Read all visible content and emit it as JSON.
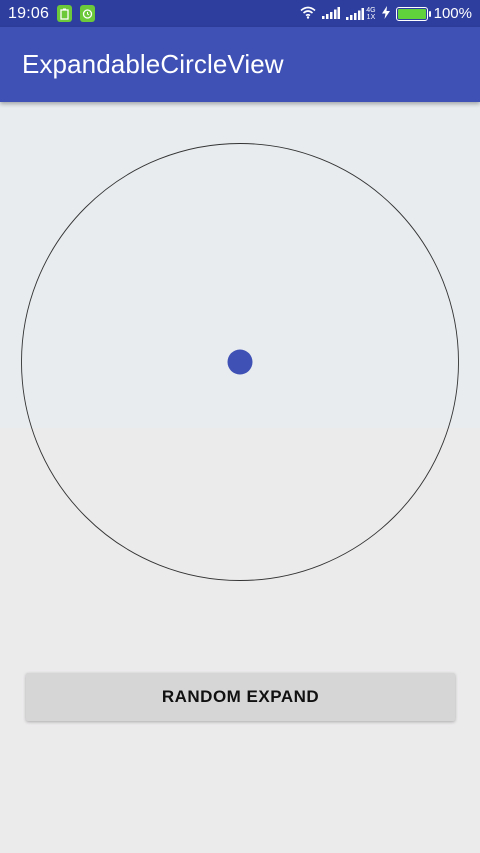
{
  "status_bar": {
    "time": "19:06",
    "network_top": "4G",
    "network_bottom": "1X",
    "battery_percent": "100%",
    "battery_level": 1.0,
    "icons": [
      "battery-notification-icon",
      "alarm-notification-icon",
      "wifi-icon",
      "signal-icon",
      "signal-4g-icon",
      "charging-icon",
      "battery-icon"
    ]
  },
  "app_bar": {
    "title": "ExpandableCircleView"
  },
  "main": {
    "expand_button_label": "RANDOM EXPAND"
  },
  "colors": {
    "primary": "#3F51B5",
    "primary_dark": "#2E3E9E",
    "dot": "#3F51B5",
    "outline": "#333333",
    "background": "#ECEBEC",
    "panel": "#E8ECEF"
  }
}
